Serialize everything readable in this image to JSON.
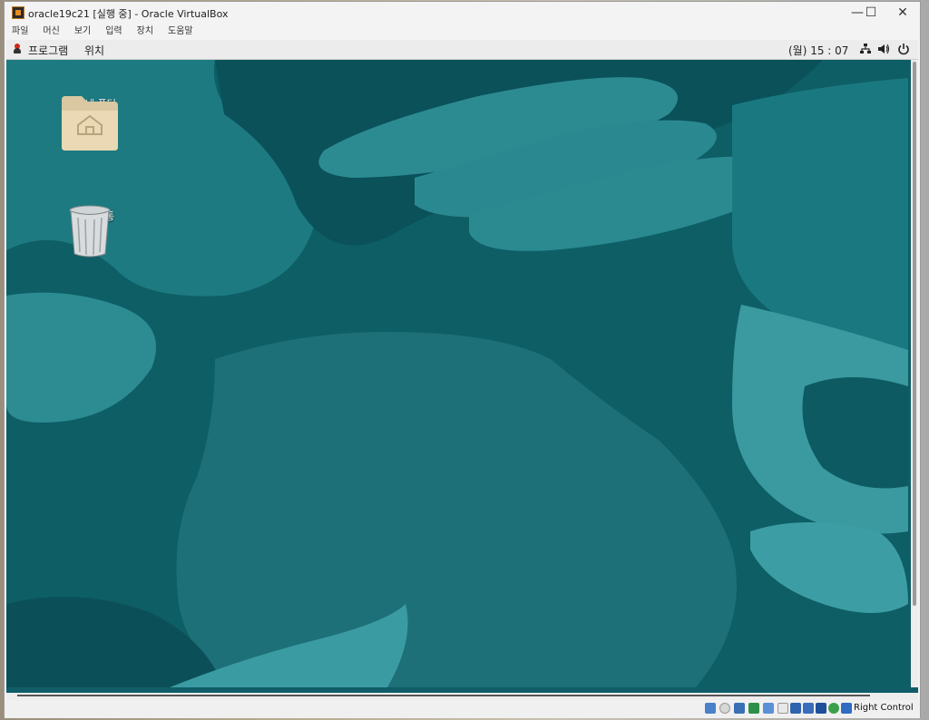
{
  "window": {
    "title": "oracle19c21 [실행 중] - Oracle VirtualBox",
    "minimize_glyph": "—",
    "maximize_glyph": "☐",
    "close_glyph": "✕"
  },
  "menubar": {
    "items": [
      "파일",
      "머신",
      "보기",
      "입력",
      "장치",
      "도움말"
    ]
  },
  "guest_panel": {
    "applications_label": "프로그램",
    "places_label": "위치",
    "clock": "(월) 15 : 07",
    "tray_icons": [
      "network-icon",
      "volume-icon",
      "power-icon"
    ]
  },
  "desktop": {
    "icons": [
      {
        "name": "home-folder",
        "label": "내 폴더"
      },
      {
        "name": "trash",
        "label": "휴지통"
      }
    ],
    "wallpaper_colors": {
      "dark": "#0e5e66",
      "mid": "#1a7a82",
      "light": "#2e8f96"
    }
  },
  "statusbar": {
    "host_key_label": "Right Control",
    "icons": [
      "hard-disk-icon",
      "optical-drive-icon",
      "audio-icon",
      "network-status-icon",
      "usb-icon",
      "shared-folders-icon",
      "display-icon",
      "recording-icon",
      "vrde-icon",
      "cpu-icon",
      "mouse-integration-icon",
      "host-key-arrow-icon"
    ]
  }
}
